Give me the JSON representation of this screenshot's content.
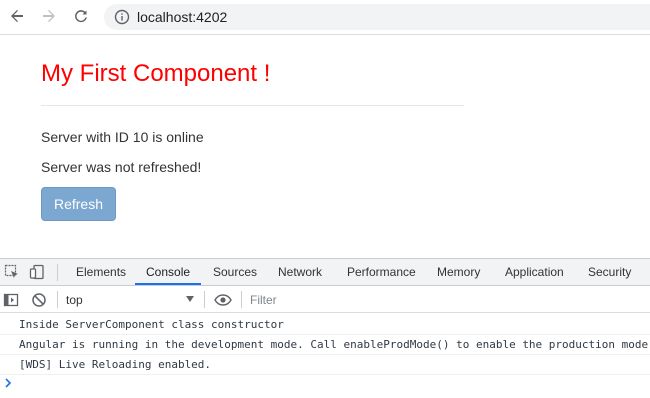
{
  "browser": {
    "url": "localhost:4202",
    "icons": [
      "back-arrow-icon",
      "forward-arrow-icon",
      "reload-icon",
      "info-icon"
    ]
  },
  "page": {
    "title": "My First Component !",
    "title_color": "#ff0000",
    "status_lines": [
      "Server with ID 10 is online",
      "Server was not refreshed!"
    ],
    "refresh_label": "Refresh",
    "button_color": "#7ba7d1"
  },
  "devtools": {
    "tabs": [
      {
        "label": "Elements",
        "active": false
      },
      {
        "label": "Console",
        "active": true
      },
      {
        "label": "Sources",
        "active": false
      },
      {
        "label": "Network",
        "active": false
      },
      {
        "label": "Performance",
        "active": false
      },
      {
        "label": "Memory",
        "active": false
      },
      {
        "label": "Application",
        "active": false
      },
      {
        "label": "Security",
        "active": false
      }
    ],
    "active_tab_color": "#1a73e8",
    "console": {
      "context": "top",
      "filter_placeholder": "Filter",
      "logs": [
        "Inside ServerComponent class constructor",
        "Angular is running in the development mode. Call enableProdMode() to enable the production mode.",
        "[WDS] Live Reloading enabled."
      ],
      "prompt_symbol": "›"
    }
  }
}
